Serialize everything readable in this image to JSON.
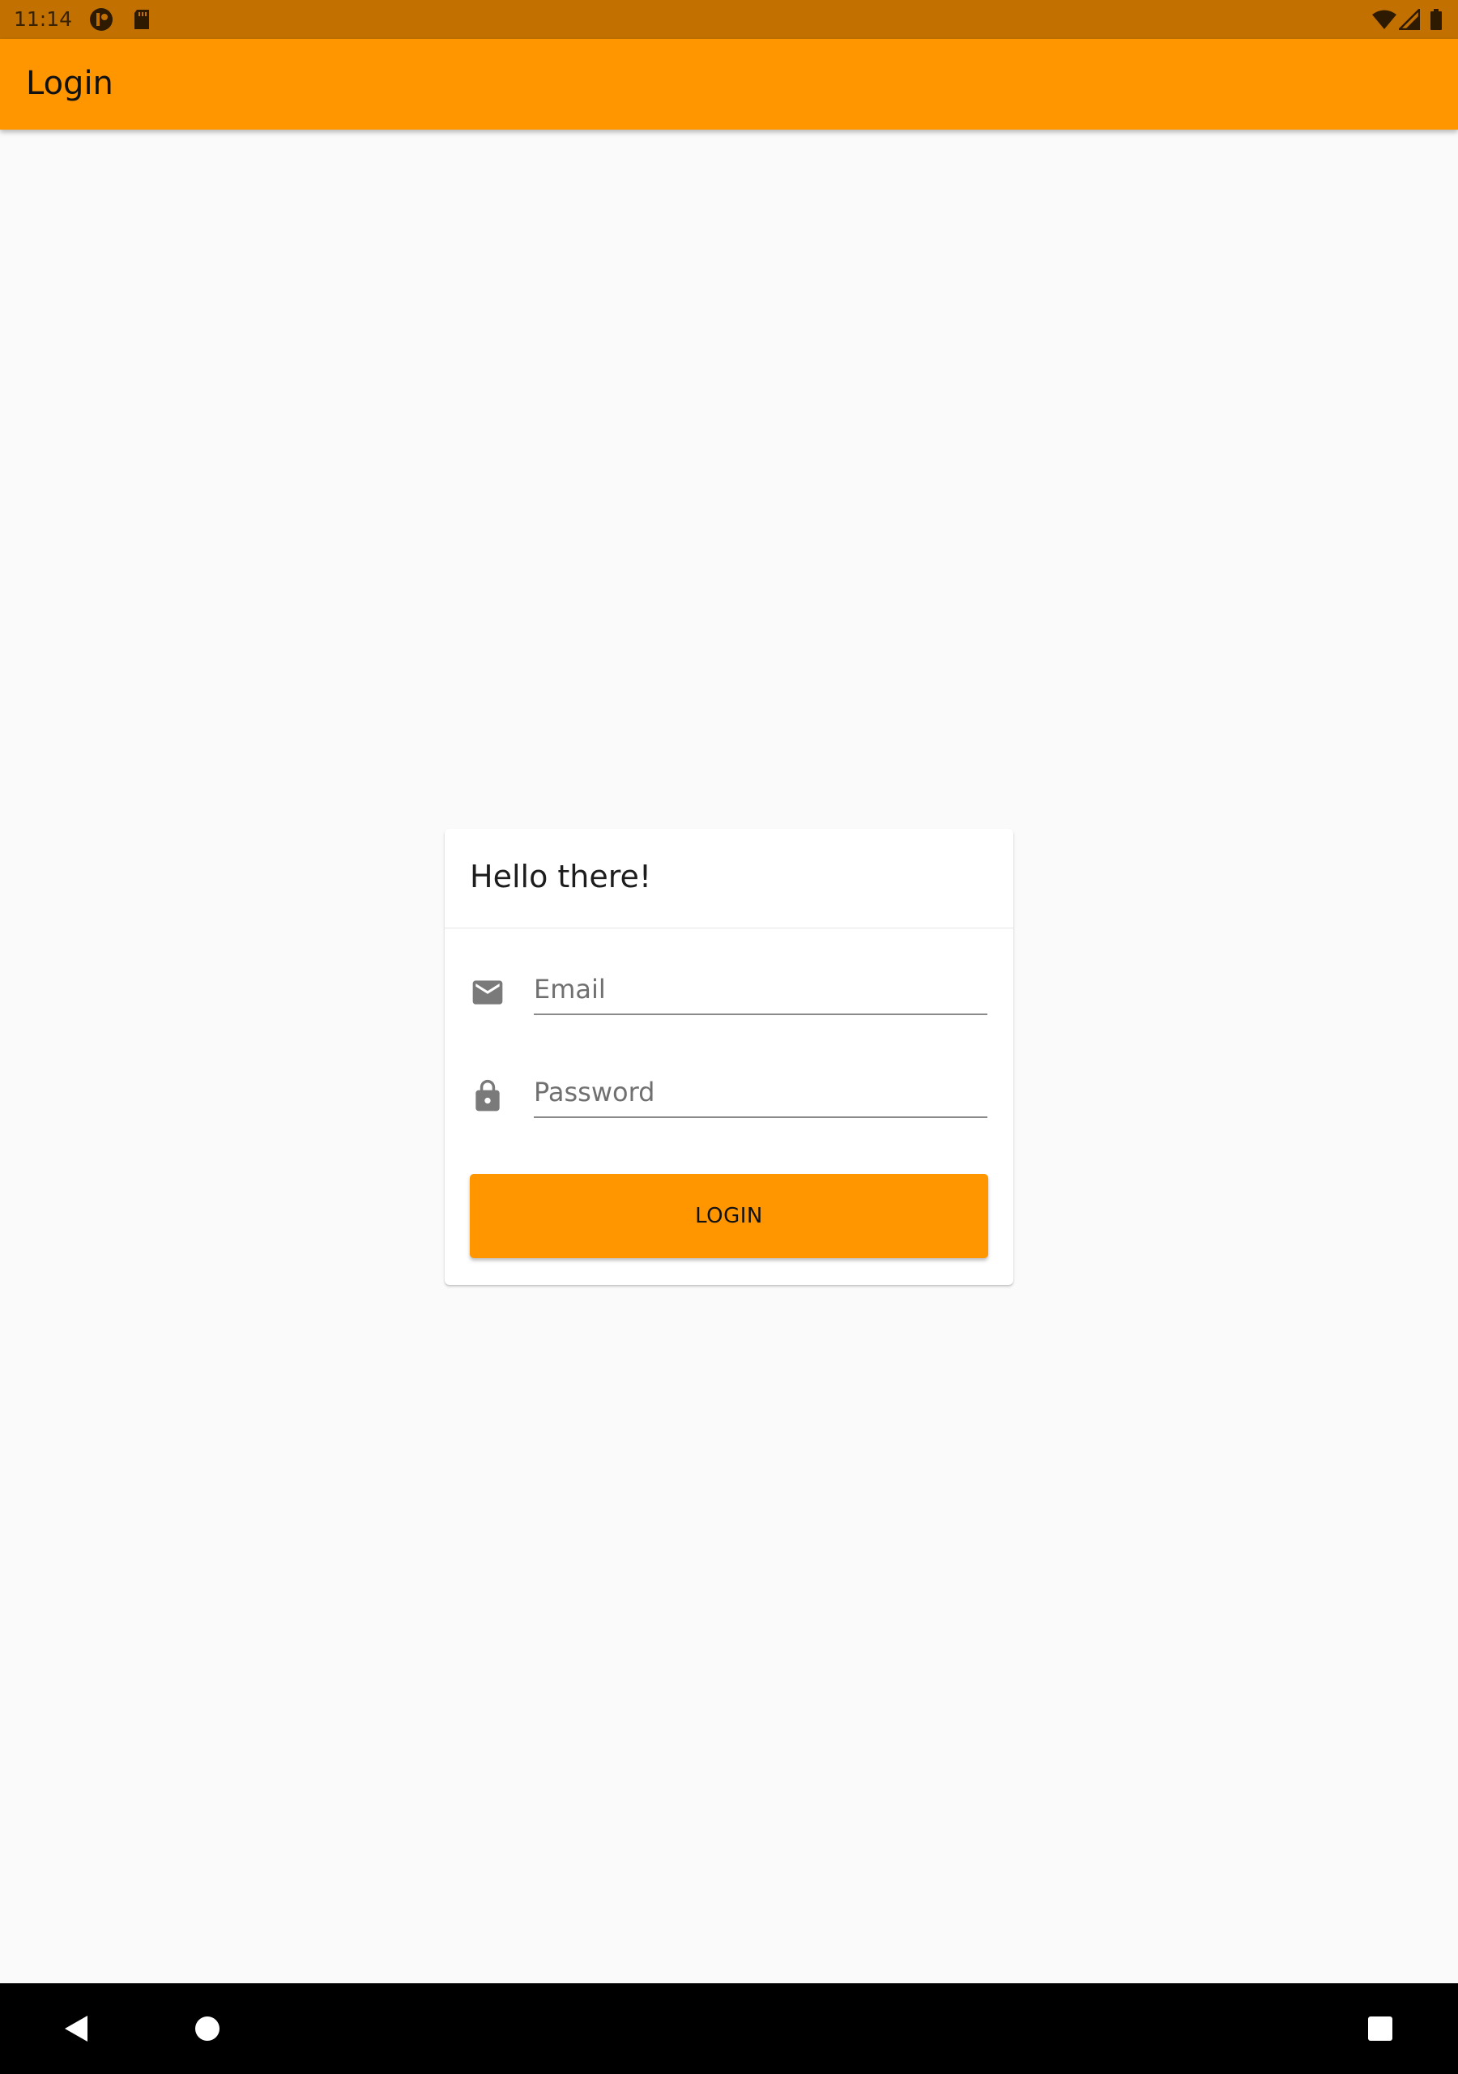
{
  "status_bar": {
    "time": "11:14",
    "left_icons": [
      "notification-app-icon",
      "sd-card-icon"
    ],
    "right_icons": [
      "wifi-icon",
      "cell-signal-icon",
      "battery-icon"
    ],
    "color": "#c27100"
  },
  "app_bar": {
    "title": "Login",
    "color": "#ff9600"
  },
  "card": {
    "title": "Hello there!",
    "email": {
      "placeholder": "Email",
      "value": "",
      "icon": "email-icon"
    },
    "password": {
      "placeholder": "Password",
      "value": "",
      "icon": "lock-icon"
    },
    "login_button": {
      "label": "LOGIN",
      "color": "#ff9600"
    }
  },
  "nav_bar": {
    "buttons": [
      "back-icon",
      "home-icon",
      "recents-icon"
    ]
  }
}
